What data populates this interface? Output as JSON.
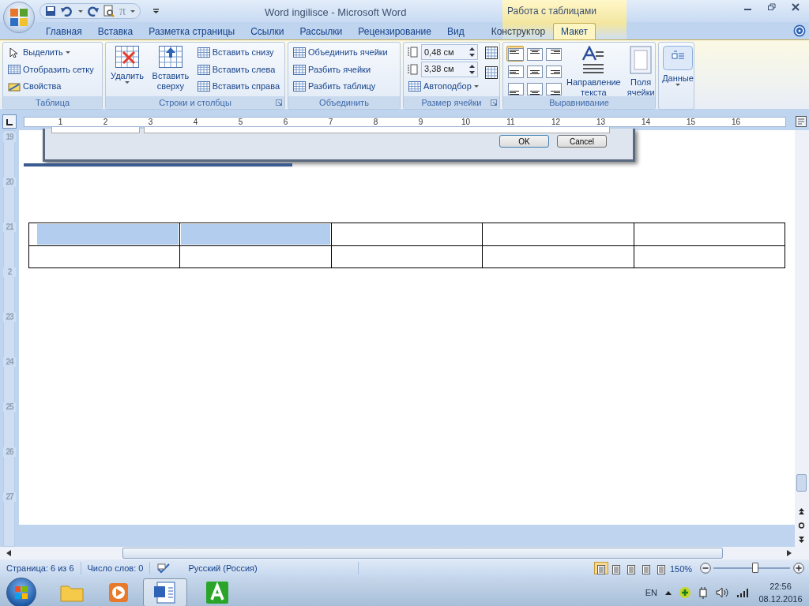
{
  "window": {
    "title": "Word ingilisce - Microsoft Word",
    "context_group": "Работа с таблицами",
    "equation_symbol": "π"
  },
  "tabs": [
    {
      "label": "Главная",
      "selected": false,
      "contextual": false
    },
    {
      "label": "Вставка",
      "selected": false,
      "contextual": false
    },
    {
      "label": "Разметка страницы",
      "selected": false,
      "contextual": false
    },
    {
      "label": "Ссылки",
      "selected": false,
      "contextual": false
    },
    {
      "label": "Рассылки",
      "selected": false,
      "contextual": false
    },
    {
      "label": "Рецензирование",
      "selected": false,
      "contextual": false
    },
    {
      "label": "Вид",
      "selected": false,
      "contextual": false
    },
    {
      "label": "Конструктор",
      "selected": false,
      "contextual": true
    },
    {
      "label": "Макет",
      "selected": true,
      "contextual": true
    }
  ],
  "ribbon": [
    {
      "title": "Таблица",
      "columns": [
        [
          {
            "kind": "small",
            "label": "Выделить",
            "dropdown": true
          },
          {
            "kind": "small",
            "label": "Отобразить сетку",
            "dropdown": false
          },
          {
            "kind": "small",
            "label": "Свойства",
            "dropdown": false
          }
        ]
      ]
    },
    {
      "title": "Строки и столбцы",
      "launcher": true,
      "columns": [
        [
          {
            "kind": "large",
            "label": "Удалить",
            "dropdown": true
          }
        ],
        [
          {
            "kind": "large",
            "label": "Вставить сверху",
            "dropdown": false
          }
        ],
        [
          {
            "kind": "small",
            "label": "Вставить снизу",
            "dropdown": false
          },
          {
            "kind": "small",
            "label": "Вставить слева",
            "dropdown": false
          },
          {
            "kind": "small",
            "label": "Вставить справа",
            "dropdown": false
          }
        ]
      ]
    },
    {
      "title": "Объединить",
      "columns": [
        [
          {
            "kind": "small",
            "label": "Объединить ячейки",
            "dropdown": false
          },
          {
            "kind": "small",
            "label": "Разбить ячейки",
            "dropdown": false
          },
          {
            "kind": "small",
            "label": "Разбить таблицу",
            "dropdown": false
          }
        ]
      ]
    },
    {
      "title": "Размер ячейки",
      "launcher": true,
      "columns": [
        [
          {
            "kind": "spinner",
            "value": "0,48 см"
          },
          {
            "kind": "spinner",
            "value": "3,38 см"
          },
          {
            "kind": "small",
            "label": "Автоподбор",
            "dropdown": true
          }
        ],
        [
          {
            "kind": "iconbtn"
          },
          {
            "kind": "iconbtn"
          }
        ]
      ]
    },
    {
      "title": "Выравнивание",
      "columns": [
        [
          {
            "kind": "aligngrid",
            "cells": [
              {
                "selected": true
              },
              {
                "selected": false
              },
              {
                "selected": false
              },
              {
                "selected": false
              },
              {
                "selected": false
              },
              {
                "selected": false
              },
              {
                "selected": false
              },
              {
                "selected": false
              },
              {
                "selected": false
              }
            ]
          }
        ],
        [
          {
            "kind": "large",
            "label": "Направление текста",
            "dropdown": false
          }
        ],
        [
          {
            "kind": "large",
            "label": "Поля ячейки",
            "dropdown": false
          }
        ]
      ]
    },
    {
      "columns": [
        [
          {
            "kind": "large",
            "label": "Данные",
            "dropdown": true
          }
        ]
      ]
    }
  ],
  "ruler": {
    "horizontal": [
      "1",
      "2",
      "3",
      "4",
      "5",
      "6",
      "7",
      "8",
      "9",
      "10",
      "11",
      "12",
      "13",
      "14",
      "15",
      "16"
    ],
    "vertical": [
      "19",
      "20",
      "21",
      "2",
      "23",
      "24",
      "25",
      "26",
      "27"
    ]
  },
  "dialog": {
    "buttons": [
      "OK",
      "Cancel"
    ]
  },
  "table": {
    "rows": [
      {
        "cells": [
          {
            "selected": true
          },
          {
            "selected": true
          },
          {
            "selected": false
          },
          {
            "selected": false
          },
          {
            "selected": false
          }
        ]
      },
      {
        "cells": [
          {
            "selected": false
          },
          {
            "selected": false
          },
          {
            "selected": false
          },
          {
            "selected": false
          },
          {
            "selected": false
          }
        ]
      }
    ]
  },
  "status_bar": {
    "items": [
      "Страница: 6 из 6",
      "Число слов: 0",
      "Русский (Россия)"
    ],
    "views": [
      {
        "selected": true
      },
      {
        "selected": false
      },
      {
        "selected": false
      },
      {
        "selected": false
      },
      {
        "selected": false
      }
    ],
    "zoom": "150%",
    "zoom_slider": {
      "level": 0.55
    }
  },
  "taskbar": {
    "apps": [
      {
        "kind": "folder",
        "active": false
      },
      {
        "kind": "media",
        "active": false
      },
      {
        "kind": "word",
        "active": true
      },
      {
        "kind": "green",
        "active": false
      }
    ],
    "language": "EN",
    "time": "22:56",
    "date": "08.12.2016"
  }
}
